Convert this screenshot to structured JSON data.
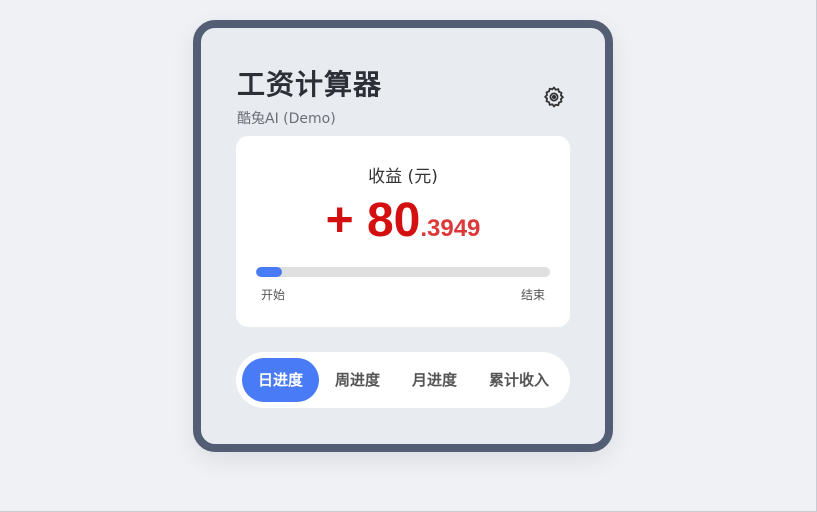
{
  "app": {
    "title": "工资计算器",
    "subtitle": "酷兔AI (Demo)"
  },
  "earnings": {
    "label": "收益 (元)",
    "sign_and_integer": "+ 80",
    "fraction": ".3949",
    "color": "#d40f0f"
  },
  "progress": {
    "fraction": 0.09,
    "start_label": "开始",
    "end_label": "结束",
    "fill_color": "#4a7bf7"
  },
  "tabs": [
    {
      "label": "日进度",
      "active": true
    },
    {
      "label": "周进度",
      "active": false
    },
    {
      "label": "月进度",
      "active": false
    },
    {
      "label": "累计收入",
      "active": false
    }
  ],
  "icons": {
    "settings": "gear-icon"
  },
  "colors": {
    "accent": "#4a7bf7",
    "frame": "#535e74"
  }
}
